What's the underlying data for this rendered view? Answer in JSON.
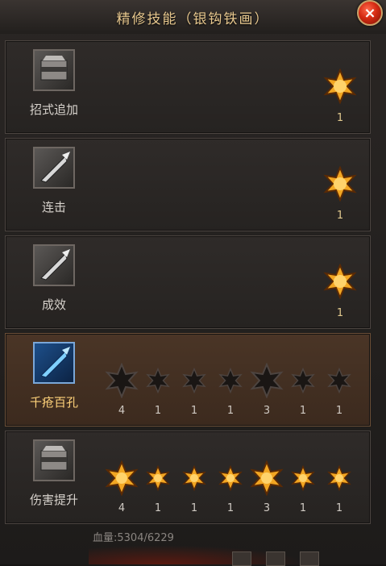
{
  "title": "精修技能（银钩铁画）",
  "close_label": "×",
  "skills": [
    {
      "name": "招式追加",
      "active": false,
      "stars": [
        {
          "value": "1",
          "lit": true
        }
      ]
    },
    {
      "name": "连击",
      "active": false,
      "stars": [
        {
          "value": "1",
          "lit": true
        }
      ]
    },
    {
      "name": "成效",
      "active": false,
      "stars": [
        {
          "value": "1",
          "lit": true
        }
      ]
    },
    {
      "name": "千疮百孔",
      "active": true,
      "stars": [
        {
          "value": "4",
          "lit": false
        },
        {
          "value": "1",
          "lit": false
        },
        {
          "value": "1",
          "lit": false
        },
        {
          "value": "1",
          "lit": false
        },
        {
          "value": "3",
          "lit": false
        },
        {
          "value": "1",
          "lit": false
        },
        {
          "value": "1",
          "lit": false
        }
      ]
    },
    {
      "name": "伤害提升",
      "active": false,
      "stars": [
        {
          "value": "4",
          "lit": true
        },
        {
          "value": "1",
          "lit": true
        },
        {
          "value": "1",
          "lit": true
        },
        {
          "value": "1",
          "lit": true
        },
        {
          "value": "3",
          "lit": true
        },
        {
          "value": "1",
          "lit": true
        },
        {
          "value": "1",
          "lit": true
        }
      ]
    }
  ],
  "hp_text": "血量:5304/6229"
}
